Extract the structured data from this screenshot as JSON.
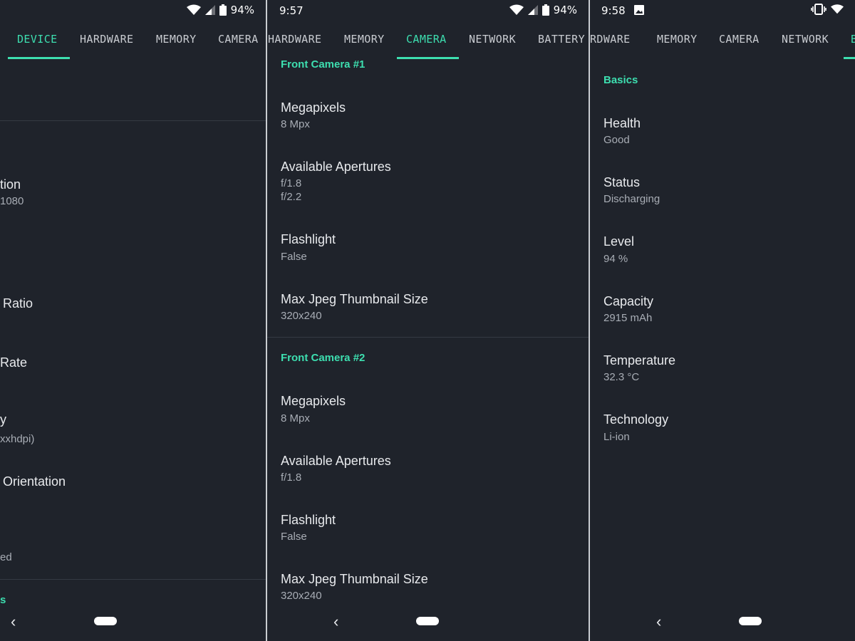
{
  "colors": {
    "background": "#1f232b",
    "accent": "#3ddfb0",
    "text": "#e8eaed",
    "secondary": "#a8adb5",
    "separator": "#c9ccd1"
  },
  "panel1": {
    "battery_pct": "94%",
    "tabs": [
      "DEVICE",
      "HARDWARE",
      "MEMORY",
      "CAMERA"
    ],
    "items": [
      {
        "label": "tion",
        "value": "1080"
      },
      {
        "label": "Ratio",
        "value": ""
      },
      {
        "label": "Rate",
        "value": ""
      },
      {
        "label": "y",
        "value": "xxhdpi)"
      },
      {
        "label": "Orientation",
        "value": ""
      },
      {
        "label": "",
        "value": "ed"
      }
    ],
    "partial_section": "s"
  },
  "panel2": {
    "time": "9:57",
    "battery_pct": "94%",
    "tabs": [
      "HARDWARE",
      "MEMORY",
      "CAMERA",
      "NETWORK",
      "BATTERY"
    ],
    "sections": [
      {
        "title": "Front Camera #1",
        "items": [
          {
            "label": "Megapixels",
            "value": "8 Mpx"
          },
          {
            "label": "Available Apertures",
            "value": "f/1.8\nf/2.2"
          },
          {
            "label": "Flashlight",
            "value": "False"
          },
          {
            "label": "Max Jpeg Thumbnail Size",
            "value": "320x240"
          }
        ]
      },
      {
        "title": "Front Camera #2",
        "items": [
          {
            "label": "Megapixels",
            "value": "8 Mpx"
          },
          {
            "label": "Available Apertures",
            "value": "f/1.8"
          },
          {
            "label": "Flashlight",
            "value": "False"
          },
          {
            "label": "Max Jpeg Thumbnail Size",
            "value": "320x240"
          }
        ]
      }
    ]
  },
  "panel3": {
    "time": "9:58",
    "tabs": [
      "RDWARE",
      "MEMORY",
      "CAMERA",
      "NETWORK",
      "B"
    ],
    "section_title": "Basics",
    "items": [
      {
        "label": "Health",
        "value": "Good"
      },
      {
        "label": "Status",
        "value": "Discharging"
      },
      {
        "label": "Level",
        "value": "94 %"
      },
      {
        "label": "Capacity",
        "value": "2915 mAh"
      },
      {
        "label": "Temperature",
        "value": "32.3 °C"
      },
      {
        "label": "Technology",
        "value": "Li-ion"
      }
    ]
  },
  "nav": {
    "back_glyph": "‹"
  }
}
